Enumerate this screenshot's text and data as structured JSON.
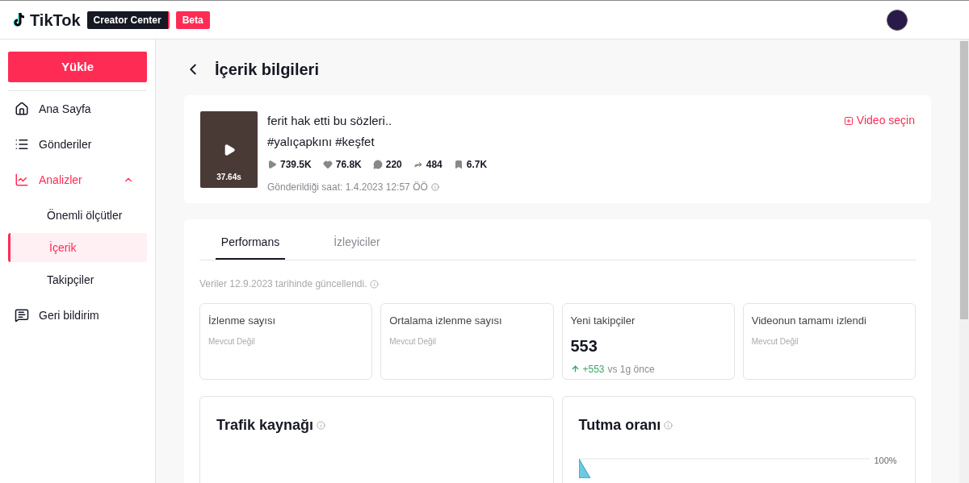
{
  "header": {
    "logo": "TikTok",
    "product": "Creator Center",
    "badge": "Beta"
  },
  "sidebar": {
    "upload": "Yükle",
    "items": [
      {
        "label": "Ana Sayfa",
        "kind": "top",
        "selected": false
      },
      {
        "label": "Gönderiler",
        "kind": "top",
        "selected": false
      },
      {
        "label": "Analizler",
        "kind": "group",
        "selected": true,
        "expanded": true,
        "children": [
          {
            "label": "Önemli ölçütler",
            "selected": false
          },
          {
            "label": "İçerik",
            "selected": true
          },
          {
            "label": "Takipçiler",
            "selected": false
          }
        ]
      },
      {
        "label": "Geri bildirim",
        "kind": "top",
        "selected": false
      }
    ]
  },
  "page_title": "İçerik bilgileri",
  "video": {
    "duration": "37.64s",
    "title": "ferit hak etti bu sözleri..",
    "hashtags": "#yalıçapkını #keşfet",
    "stats": [
      "739.5K",
      "76.8K",
      "220",
      "484",
      "6.7K"
    ],
    "posted": "Gönderildiği saat: 1.4.2023 12:57 ÖÖ",
    "select": "Video seçin"
  },
  "tabs": [
    {
      "label": "Performans",
      "selected": true
    },
    {
      "label": "İzleyiciler",
      "selected": false
    }
  ],
  "updated": "Veriler 12.9.2023 tarihinde güncellendi.",
  "metrics": [
    {
      "label": "İzlenme sayısı",
      "kind": "na",
      "value": "Mevcut Değil"
    },
    {
      "label": "Ortalama izlenme sayısı",
      "kind": "na",
      "value": "Mevcut Değil"
    },
    {
      "label": "Yeni takipçiler",
      "kind": "value",
      "value": "553",
      "delta": "+553",
      "compare": "vs 1g önce"
    },
    {
      "label": "Videonun tamamı izlendi",
      "kind": "na",
      "value": "Mevcut Değil"
    }
  ],
  "traffic": {
    "title": "Trafik kaynağı"
  },
  "retention": {
    "title": "Tutma oranı",
    "tick": "100%"
  }
}
